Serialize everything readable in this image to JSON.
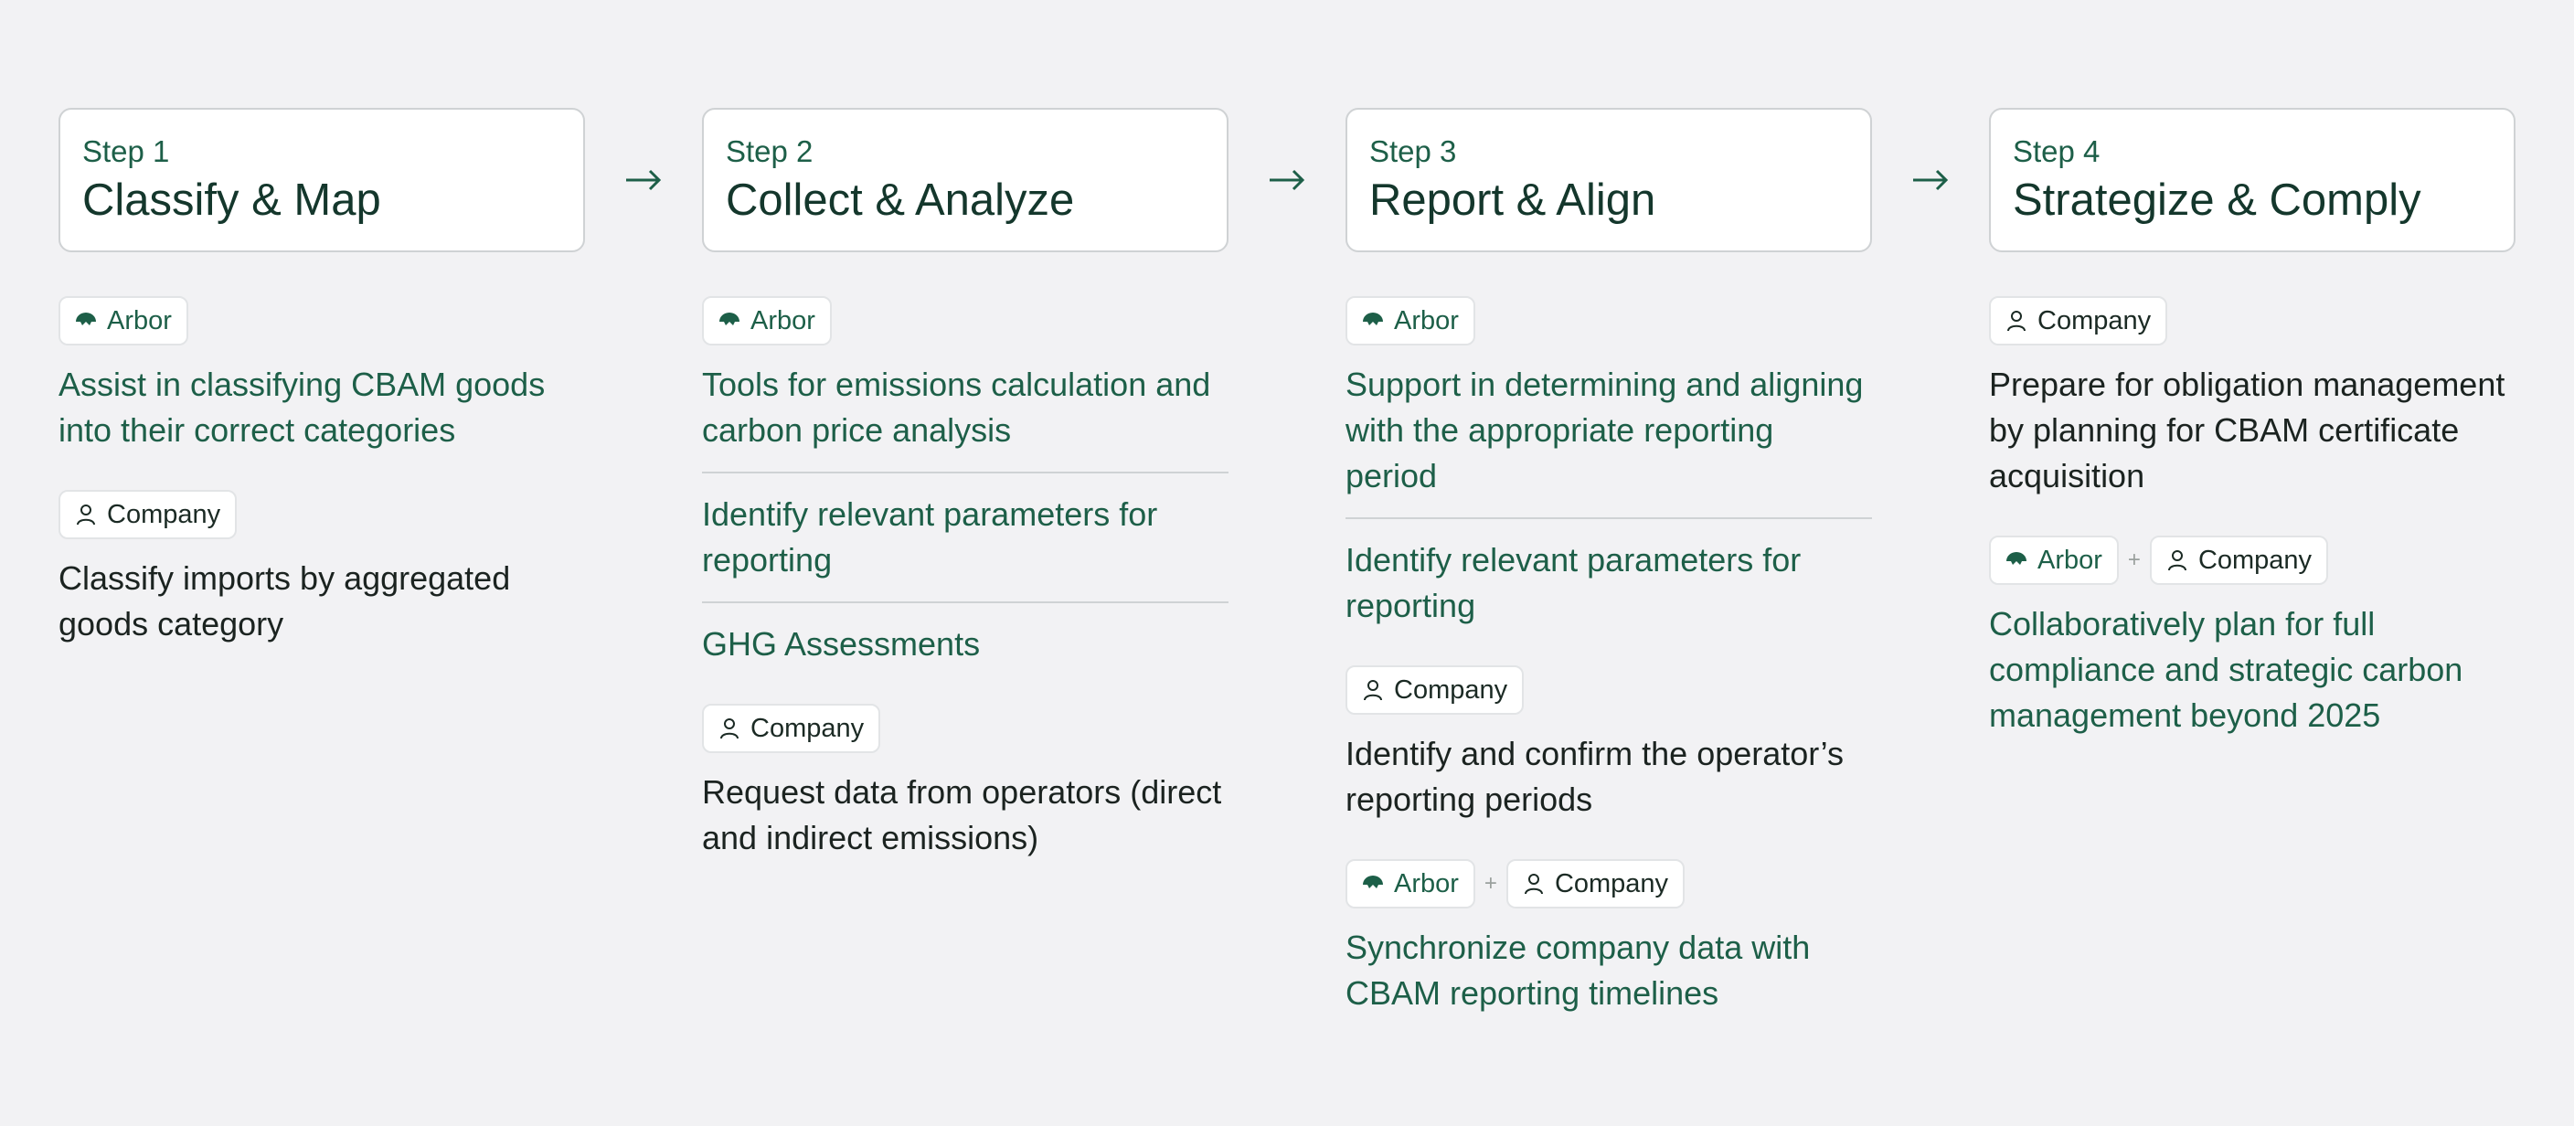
{
  "steps": [
    {
      "label": "Step 1",
      "title": "Classify & Map",
      "groups": [
        {
          "tags": [
            "Arbor"
          ],
          "items": [
            "Assist in classifying CBAM goods into their correct categories"
          ],
          "tone": "green"
        },
        {
          "tags": [
            "Company"
          ],
          "items": [
            "Classify imports by aggregated goods category"
          ],
          "tone": "dark"
        }
      ]
    },
    {
      "label": "Step 2",
      "title": "Collect & Analyze",
      "groups": [
        {
          "tags": [
            "Arbor"
          ],
          "items": [
            "Tools for emissions calculation and carbon price analysis",
            "Identify relevant parameters for reporting",
            "GHG Assessments"
          ],
          "tone": "green"
        },
        {
          "tags": [
            "Company"
          ],
          "items": [
            "Request data from operators (direct and indirect emissions)"
          ],
          "tone": "dark"
        }
      ]
    },
    {
      "label": "Step 3",
      "title": "Report & Align",
      "groups": [
        {
          "tags": [
            "Arbor"
          ],
          "items": [
            "Support in determining and aligning with the appropriate reporting period",
            "Identify relevant parameters for reporting"
          ],
          "tone": "green"
        },
        {
          "tags": [
            "Company"
          ],
          "items": [
            "Identify and confirm the operator’s reporting periods"
          ],
          "tone": "dark"
        },
        {
          "tags": [
            "Arbor",
            "Company"
          ],
          "plus": "+",
          "items": [
            "Synchronize company data with CBAM reporting timelines"
          ],
          "tone": "green"
        }
      ]
    },
    {
      "label": "Step 4",
      "title": "Strategize & Comply",
      "groups": [
        {
          "tags": [
            "Company"
          ],
          "items": [
            "Prepare for obligation management by planning for CBAM certificate acquisition"
          ],
          "tone": "dark"
        },
        {
          "tags": [
            "Arbor",
            "Company"
          ],
          "plus": "+",
          "items": [
            "Collaboratively plan for full compliance and strategic carbon management beyond 2025"
          ],
          "tone": "green"
        }
      ]
    }
  ],
  "arrow_icon": "arrow-right-icon",
  "icons": {
    "arbor": "arbor-logo-icon",
    "company": "person-icon"
  },
  "colors": {
    "accent_green": "#1d5f48",
    "title_dark": "#14372c",
    "text_dark": "#1b2320",
    "background": "#f2f2f4"
  }
}
